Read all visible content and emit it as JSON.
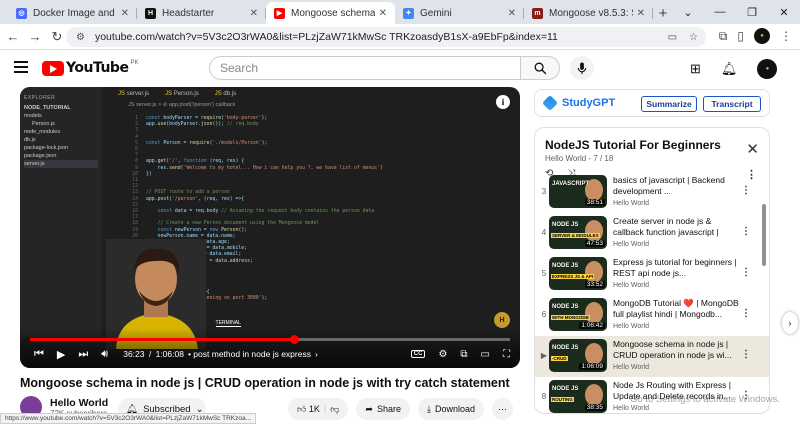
{
  "browser": {
    "tabs": [
      {
        "title": "Docker Image and Networking",
        "color": "#4a6cf7",
        "glyph": "◎",
        "active": false
      },
      {
        "title": "Headstarter",
        "color": "#111111",
        "glyph": "H",
        "active": false
      },
      {
        "title": "Mongoose schema in node js",
        "color": "#ff0000",
        "glyph": "▶",
        "active": true
      },
      {
        "title": "Gemini",
        "color": "#4285f4",
        "glyph": "✦",
        "active": false
      },
      {
        "title": "Mongoose v8.5.3: Schemas",
        "color": "#8b1a1a",
        "glyph": "m",
        "active": false
      }
    ],
    "url": "youtube.com/watch?v=5V3c2O3rWA0&list=PLzjZaW71kMwSc TRKzoasdyB1sX-a9EbFp&index=11",
    "status_url": "https://www.youtube.com/watch?v=5V3c2O3rWA0&list=PLzjZaW71kMwSc TRKzoa..."
  },
  "youtube": {
    "logo_text": "YouTube",
    "country": "PK",
    "search_placeholder": "Search"
  },
  "video": {
    "current_time": "36:23",
    "duration": "1:06:08",
    "progress": 0.5502,
    "chapter": "• post method in node js express",
    "title": "Mongoose schema in node js | CRUD operation in node js with try catch statement",
    "channel": "Hello World",
    "subscribers": "72K subscribers",
    "subscribed_label": "Subscribed",
    "likes": "1K",
    "share_label": "Share",
    "download_label": "Download"
  },
  "editor": {
    "explorer_label": "EXPLORER",
    "project": "NODE_TUTORIAL",
    "files": [
      "models",
      "Person.js",
      "node_modules",
      "db.js",
      "package-lock.json",
      "package.json",
      "server.js"
    ],
    "tabs": [
      "server.js",
      "Person.js",
      "db.js"
    ],
    "breadcrumb": "JS server.js > ⊘ app.post('/person') callback",
    "panel_tabs": [
      "PROBLEMS",
      "OUTPUT",
      "COMMENTS",
      "TERMINAL"
    ]
  },
  "studygpt": {
    "name": "StudyGPT",
    "summarize_label": "Summarize",
    "transcript_label": "Transcript"
  },
  "playlist": {
    "title": "NodeJS Tutorial For Beginners",
    "subtitle": "Hello World - 7 / 18",
    "items": [
      {
        "index": "3",
        "title": "basics of javascript | Backend development ...",
        "channel": "Hello World",
        "duration": "38:51",
        "thumb_text": "JAVASCRIPT",
        "thumb_label": "",
        "current": false
      },
      {
        "index": "4",
        "title": "Create server in node js & callback function javascript | Backend...",
        "channel": "Hello World",
        "duration": "47:53",
        "thumb_text": "NODE JS",
        "thumb_label": "SERVER & MODULES",
        "current": false
      },
      {
        "index": "5",
        "title": "Express js tutorial for beginners | REST api node js...",
        "channel": "Hello World",
        "duration": "33:52",
        "thumb_text": "NODE JS",
        "thumb_label": "EXPRESS JS & API",
        "current": false
      },
      {
        "index": "6",
        "title": "MongoDB Tutorial ❤️ | MongoDB full playlist hindi | Mongodb...",
        "channel": "Hello World",
        "duration": "1:06:42",
        "thumb_text": "NODE JS",
        "thumb_label": "WITH MONGODB",
        "current": false
      },
      {
        "index": "▶",
        "title": "Mongoose schema in node js | CRUD operation in node js wi...",
        "channel": "Hello World",
        "duration": "1:06:09",
        "thumb_text": "NODE JS",
        "thumb_label": "-CRUD",
        "current": true
      },
      {
        "index": "8",
        "title": "Node Js Routing with Express | Update and Delete records in...",
        "channel": "Hello World",
        "duration": "38:35",
        "thumb_text": "NODE JS",
        "thumb_label": "ROUTING",
        "current": false
      }
    ]
  },
  "os": {
    "watermark": "Go to Settings to activate Windows."
  },
  "colors": {
    "youtube_red": "#ff0000",
    "studygpt_blue": "#1a73e8",
    "current_row": "#ede8de"
  }
}
